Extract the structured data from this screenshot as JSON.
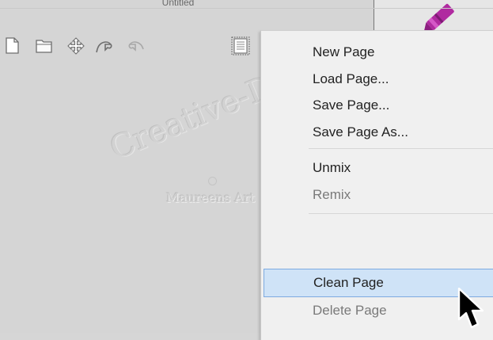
{
  "window": {
    "title": "Untitled"
  },
  "toolbar": {
    "buttons": [
      {
        "name": "new-page-icon"
      },
      {
        "name": "folder-icon"
      },
      {
        "name": "move-icon"
      },
      {
        "name": "undo-icon"
      },
      {
        "name": "redo-icon"
      },
      {
        "name": "page-menu-icon"
      }
    ]
  },
  "watermark": {
    "line1": "Creative-Designs",
    "line2": "Maureens Art"
  },
  "menu": {
    "items": [
      {
        "label": "New Page",
        "enabled": true
      },
      {
        "label": "Load Page...",
        "enabled": true
      },
      {
        "label": "Save Page...",
        "enabled": true
      },
      {
        "label": "Save Page As...",
        "enabled": true
      },
      {
        "label": "Unmix",
        "enabled": true
      },
      {
        "label": "Remix",
        "enabled": false
      },
      {
        "label": "Clean Page",
        "enabled": true,
        "highlighted": true
      },
      {
        "label": "Delete Page",
        "enabled": false
      }
    ]
  },
  "colors": {
    "highlight_bg": "#cfe3f7",
    "highlight_border": "#7daae0",
    "crayon": "#b02aa0"
  }
}
